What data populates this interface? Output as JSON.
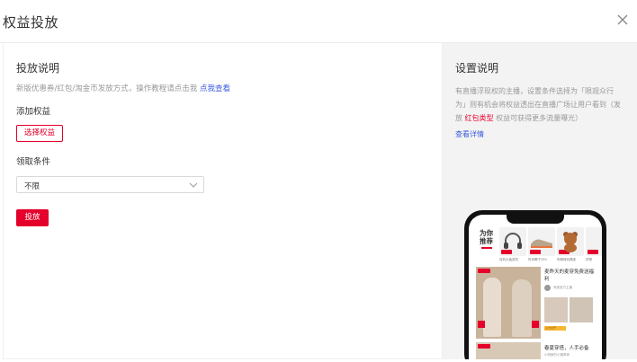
{
  "modal": {
    "title": "权益投放"
  },
  "left": {
    "section_title": "投放说明",
    "description": "新版优惠券/红包/淘金币发放方式，操作教程请点击我 ",
    "description_link": "点我查看",
    "add_label": "添加权益",
    "select_button": "选择权益",
    "condition_label": "领取条件",
    "condition_value": "不限",
    "submit_button": "投放"
  },
  "right": {
    "title": "设置说明",
    "text_part1": "有直播浮现权的主播，设置条件选择为「限观众行为」则有机会将权益透出在直播广场让用户看到（发放 ",
    "text_highlight": "红包类型",
    "text_part2": " 权益可获得更多流量曝光）",
    "link": "查看详情"
  },
  "phone": {
    "tab_label": "为你推荐",
    "products": [
      {
        "caption": "耳机大抽奖机"
      },
      {
        "caption": "时尚椰子350"
      },
      {
        "caption": "布朗熊玩偶宝"
      },
      {
        "caption": "好物"
      }
    ],
    "card1_title": "麦昨天的麦穿免费送福利",
    "card1_shop": "淘宝官方主播",
    "card1_coupon": "火力全开",
    "card2_title": "春夏穿搭，人手必备",
    "card2_shop": "小明家的小猪佩奇"
  },
  "colors": {
    "accent": "#e4002b",
    "link": "#3b5bdb",
    "muted": "#999999",
    "right_panel_bg": "#f3f3f3"
  },
  "icons": {
    "close": "close-icon",
    "chevron": "chevron-down-icon"
  }
}
